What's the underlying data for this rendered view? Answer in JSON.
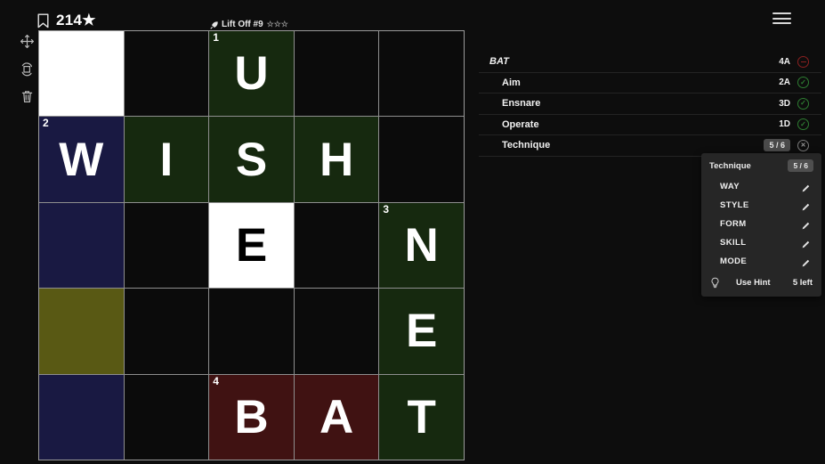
{
  "topbar": {
    "bookmark_icon": "bookmark-icon",
    "score": "214★",
    "puzzle_title": "Lift Off #9",
    "rocket_icon": "rocket-icon",
    "stars": "☆☆☆",
    "menu_icon": "hamburger-menu-icon"
  },
  "tools": [
    {
      "name": "move-tool",
      "icon": "move-arrows-icon"
    },
    {
      "name": "rotate-tool",
      "icon": "rotate-icon"
    },
    {
      "name": "delete-tool",
      "icon": "trash-icon"
    }
  ],
  "grid": {
    "rows": 5,
    "cols": 5,
    "cells": [
      {
        "letter": "",
        "num": "",
        "bg": "#ffffff",
        "fg": "#000000"
      },
      {
        "letter": "",
        "num": "",
        "bg": "#0b0b0b",
        "fg": "#ffffff"
      },
      {
        "letter": "U",
        "num": "1",
        "bg": "#16290f",
        "fg": "#ffffff"
      },
      {
        "letter": "",
        "num": "",
        "bg": "#0b0b0b",
        "fg": "#ffffff"
      },
      {
        "letter": "",
        "num": "",
        "bg": "#0b0b0b",
        "fg": "#ffffff"
      },
      {
        "letter": "W",
        "num": "2",
        "bg": "#191942",
        "fg": "#ffffff"
      },
      {
        "letter": "I",
        "num": "",
        "bg": "#16290f",
        "fg": "#ffffff"
      },
      {
        "letter": "S",
        "num": "",
        "bg": "#16290f",
        "fg": "#ffffff"
      },
      {
        "letter": "H",
        "num": "",
        "bg": "#16290f",
        "fg": "#ffffff"
      },
      {
        "letter": "",
        "num": "",
        "bg": "#0b0b0b",
        "fg": "#ffffff"
      },
      {
        "letter": "",
        "num": "",
        "bg": "#191942",
        "fg": "#ffffff"
      },
      {
        "letter": "",
        "num": "",
        "bg": "#0b0b0b",
        "fg": "#ffffff"
      },
      {
        "letter": "E",
        "num": "",
        "bg": "#ffffff",
        "fg": "#000000"
      },
      {
        "letter": "",
        "num": "",
        "bg": "#0b0b0b",
        "fg": "#ffffff"
      },
      {
        "letter": "N",
        "num": "3",
        "bg": "#16290f",
        "fg": "#ffffff"
      },
      {
        "letter": "",
        "num": "",
        "bg": "#595914",
        "fg": "#ffffff"
      },
      {
        "letter": "",
        "num": "",
        "bg": "#0b0b0b",
        "fg": "#ffffff"
      },
      {
        "letter": "",
        "num": "",
        "bg": "#0b0b0b",
        "fg": "#ffffff"
      },
      {
        "letter": "",
        "num": "",
        "bg": "#0b0b0b",
        "fg": "#ffffff"
      },
      {
        "letter": "E",
        "num": "",
        "bg": "#16290f",
        "fg": "#ffffff"
      },
      {
        "letter": "",
        "num": "",
        "bg": "#191942",
        "fg": "#ffffff"
      },
      {
        "letter": "",
        "num": "",
        "bg": "#0b0b0b",
        "fg": "#ffffff"
      },
      {
        "letter": "B",
        "num": "4",
        "bg": "#401212",
        "fg": "#ffffff"
      },
      {
        "letter": "A",
        "num": "",
        "bg": "#401212",
        "fg": "#ffffff"
      },
      {
        "letter": "T",
        "num": "",
        "bg": "#16290f",
        "fg": "#ffffff"
      }
    ]
  },
  "clues": [
    {
      "label": "BAT",
      "ref": "4A",
      "status": "minus",
      "active": true,
      "count": ""
    },
    {
      "label": "Aim",
      "ref": "2A",
      "status": "check",
      "active": false,
      "count": ""
    },
    {
      "label": "Ensnare",
      "ref": "3D",
      "status": "check",
      "active": false,
      "count": ""
    },
    {
      "label": "Operate",
      "ref": "1D",
      "status": "check",
      "active": false,
      "count": ""
    },
    {
      "label": "Technique",
      "ref": "",
      "status": "cross",
      "active": false,
      "count": "5 / 6"
    }
  ],
  "popup": {
    "title": "Technique",
    "count": "5 / 6",
    "synonyms": [
      {
        "label": "WAY",
        "icon": "pencil-icon"
      },
      {
        "label": "STYLE",
        "icon": "pencil-icon"
      },
      {
        "label": "FORM",
        "icon": "pencil-icon"
      },
      {
        "label": "SKILL",
        "icon": "pencil-icon"
      },
      {
        "label": "MODE",
        "icon": "pencil-icon"
      }
    ],
    "hint_icon": "lightbulb-icon",
    "hint_label": "Use Hint",
    "hint_left": "5 left"
  },
  "colors": {
    "green_cell": "#16290f",
    "navy_cell": "#191942",
    "olive_cell": "#595914",
    "red_cell": "#401212",
    "white_cell": "#ffffff",
    "black_cell": "#0b0b0b",
    "status_ok": "#2e7d32",
    "status_error": "#8a2020"
  }
}
